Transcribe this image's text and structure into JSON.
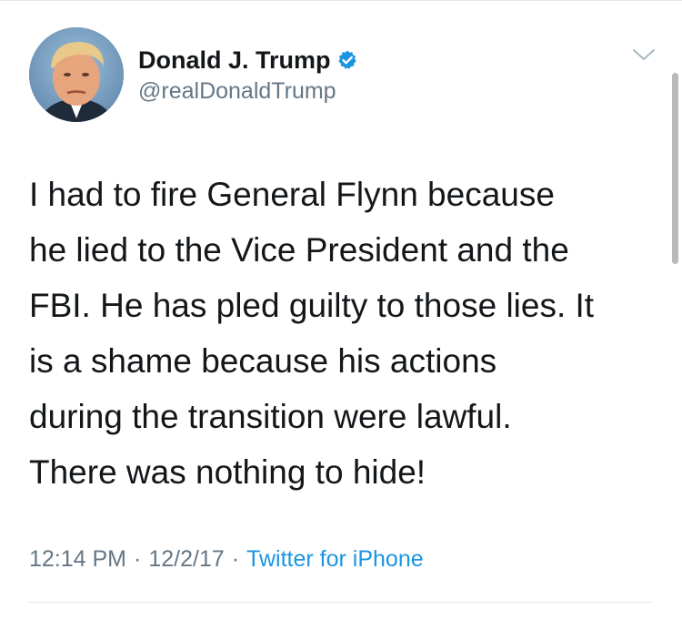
{
  "tweet": {
    "author": {
      "display_name": "Donald J. Trump",
      "handle": "@realDonaldTrump",
      "verified": true,
      "avatar_icon": "profile-photo"
    },
    "text_lines": [
      "I had to fire General Flynn because",
      "he lied to the Vice President and the",
      "FBI. He has pled guilty to those lies. It",
      "is a shame because his actions",
      "during the transition were lawful.",
      "There was nothing to hide!"
    ],
    "time": "12:14 PM",
    "separator": "·",
    "date": "12/2/17",
    "source": "Twitter for iPhone"
  },
  "colors": {
    "text": "#14171a",
    "secondary": "#657786",
    "accent": "#1b95e0",
    "divider": "#e1e8ed"
  },
  "icons": {
    "verified": "verified-badge-icon",
    "menu": "chevron-down-icon"
  }
}
